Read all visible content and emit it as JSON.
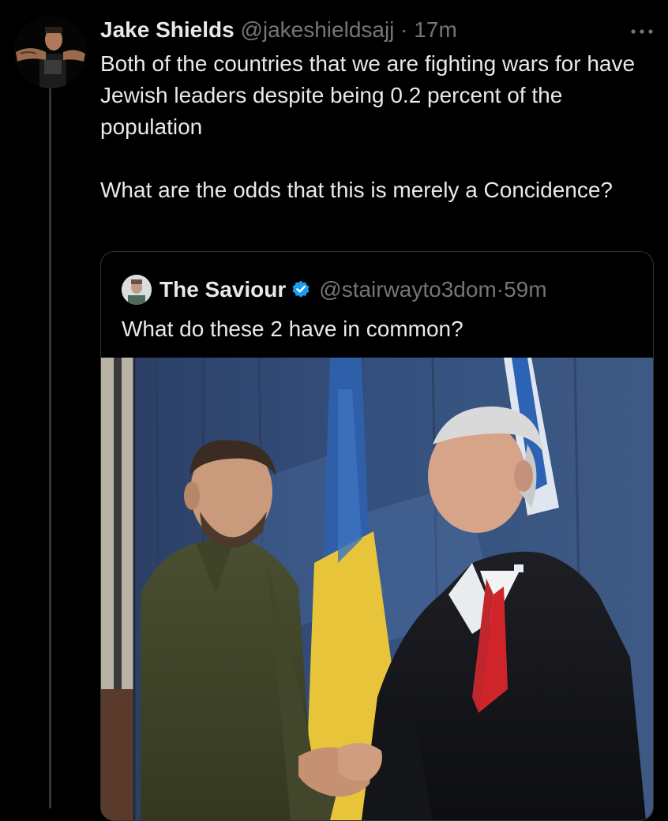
{
  "tweet": {
    "author_name": "Jake Shields",
    "author_handle": "@jakeshieldsajj",
    "separator": " · ",
    "time": "17m",
    "more_icon": "more-horizontal-icon",
    "text_line1": "Both of the countries that we are fighting wars for have Jewish leaders despite being 0.2 percent  of the population",
    "text_line2": "What are the odds that this is merely a Concidence?"
  },
  "quote": {
    "author_name": "The Saviour",
    "verified_icon": "verified-badge-icon",
    "author_handle": "@stairwayto3dom",
    "separator": " · ",
    "time": "59m",
    "text": "What do these 2 have in common?"
  },
  "colors": {
    "background": "#000000",
    "text": "#e7e9ea",
    "secondary": "#71767b",
    "border": "#2f3336",
    "verified": "#1d9bf0"
  }
}
